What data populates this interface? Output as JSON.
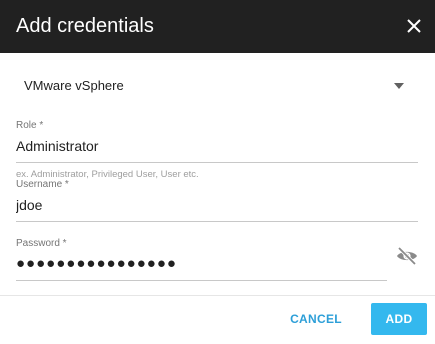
{
  "dialog": {
    "title": "Add credentials"
  },
  "icons": {
    "close": "close-icon",
    "dropdown": "chevron-down-icon",
    "visibility": "eye-off-icon"
  },
  "provider_select": {
    "value": "VMware vSphere"
  },
  "role": {
    "label": "Role *",
    "value": "Administrator",
    "hint": "ex. Administrator, Privileged User, User etc."
  },
  "username": {
    "label": "Username *",
    "value": "jdoe"
  },
  "password": {
    "label": "Password *",
    "masked_value": "●●●●●●●●●●●●●●●●"
  },
  "actions": {
    "cancel_label": "CANCEL",
    "add_label": "ADD"
  },
  "colors": {
    "titlebar": "#212121",
    "accent": "#34b8ee",
    "cancel_text": "#2d9fd8",
    "label": "#757575",
    "hint": "#9e9e9e"
  }
}
